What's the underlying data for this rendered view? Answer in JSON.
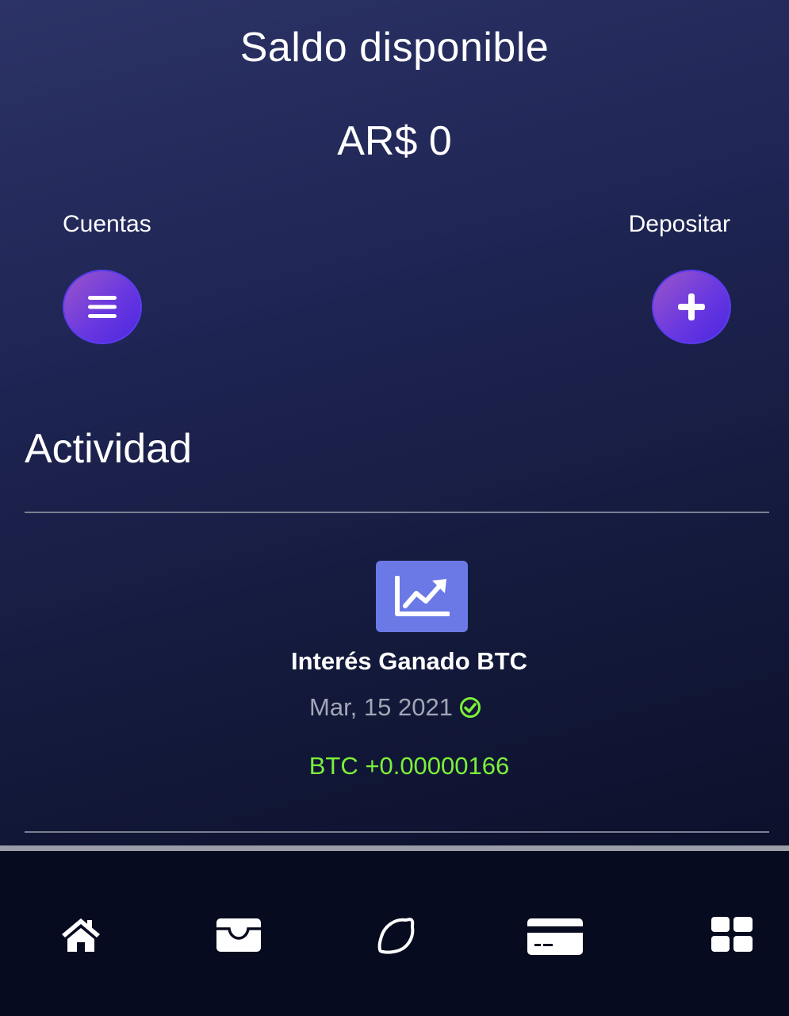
{
  "header": {
    "balance_title": "Saldo disponible",
    "balance_amount": "AR$ 0"
  },
  "actions": {
    "accounts_label": "Cuentas",
    "accounts_icon": "menu-bars-icon",
    "deposit_label": "Depositar",
    "deposit_icon": "plus-icon"
  },
  "activity": {
    "section_title": "Actividad",
    "items": [
      {
        "icon": "chart-line-icon",
        "name": "Interés Ganado BTC",
        "date": "Mar, 15 2021",
        "status_icon": "check-circle-icon",
        "amount": "BTC +0.00000166"
      }
    ]
  },
  "bottom_nav": {
    "items": [
      {
        "icon": "home-icon"
      },
      {
        "icon": "wallet-icon"
      },
      {
        "icon": "lemon-icon"
      },
      {
        "icon": "credit-card-icon"
      },
      {
        "icon": "grid-icon"
      }
    ]
  },
  "colors": {
    "accent_purple": "#6a38e0",
    "activity_icon_bg": "#6a79e6",
    "positive_green": "#7cf03a",
    "check_green": "#7cf03a",
    "muted_text": "#a3a6b6",
    "nav_bg": "#070b1f"
  }
}
